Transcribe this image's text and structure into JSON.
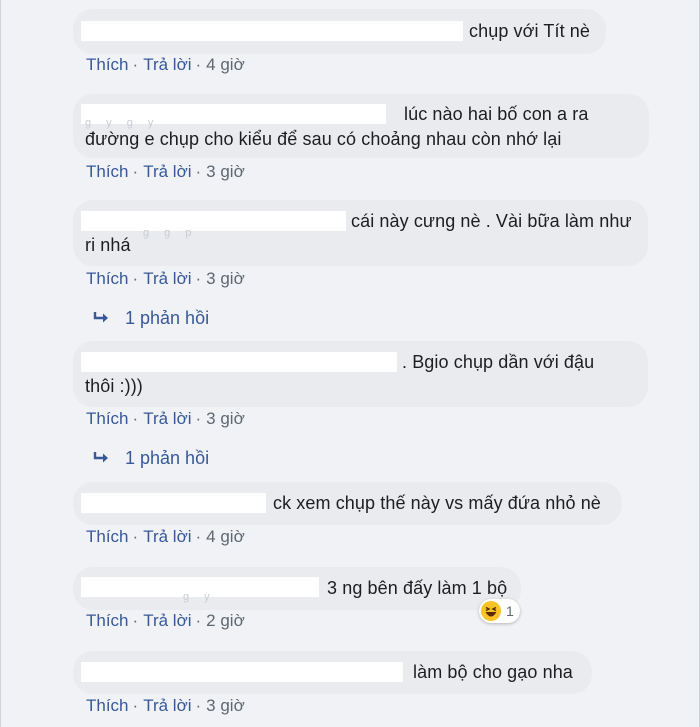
{
  "comments": [
    {
      "text": "chụp với Tít nè",
      "like": "Thích",
      "reply": "Trả lời",
      "time": "4 giờ"
    },
    {
      "line1": "lúc nào hai bố con a ra",
      "line2": "đường e chụp cho kiểu để sau có choảng nhau còn nhớ lại",
      "like": "Thích",
      "reply": "Trả lời",
      "time": "3 giờ"
    },
    {
      "line1": "cái này cưng nè . Vài bữa làm như",
      "line2": "ri nhá",
      "like": "Thích",
      "reply": "Trả lời",
      "time": "3 giờ",
      "replies": "1 phản hồi"
    },
    {
      "line1": ". Bgio chụp dần với đậu",
      "line2": "thôi :)))",
      "like": "Thích",
      "reply": "Trả lời",
      "time": "3 giờ",
      "replies": "1 phản hồi"
    },
    {
      "text": "ck xem chụp thế này vs mấy đứa nhỏ nè",
      "like": "Thích",
      "reply": "Trả lời",
      "time": "4 giờ"
    },
    {
      "text": "3 ng bên đấy làm 1 bộ",
      "reaction_count": "1",
      "reaction_icon": "haha-icon",
      "like": "Thích",
      "reply": "Trả lời",
      "time": "2 giờ"
    },
    {
      "text": "làm bộ cho gạo nha",
      "like": "Thích",
      "reply": "Trả lời",
      "time": "3 giờ"
    }
  ],
  "colors": {
    "link": "#385898",
    "muted": "#606770",
    "bubble": "#e9ebee",
    "background": "#f0f2f5"
  }
}
